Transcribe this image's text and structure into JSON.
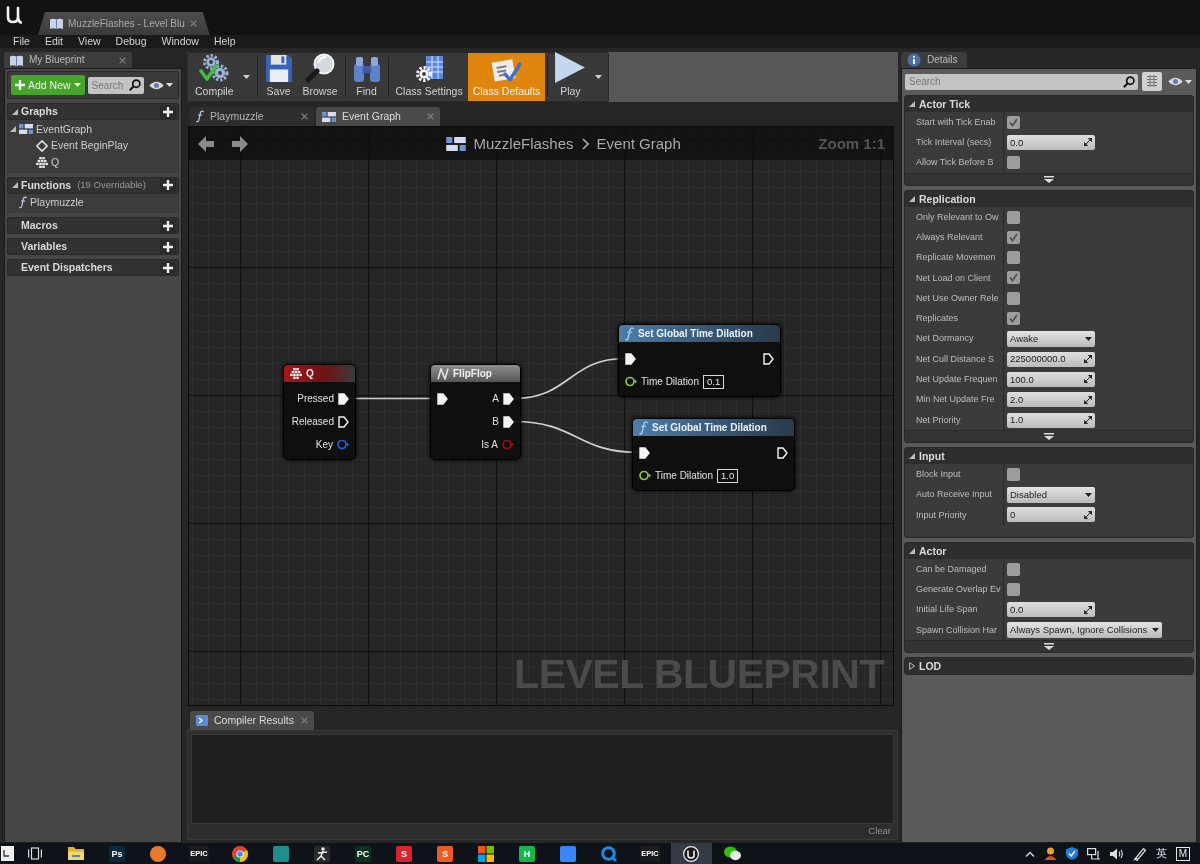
{
  "window": {
    "tab_title": "MuzzleFlashes - Level Blu"
  },
  "menu": [
    "File",
    "Edit",
    "View",
    "Debug",
    "Window",
    "Help"
  ],
  "my_blueprint": {
    "tab": "My Blueprint",
    "add_button": "Add New",
    "search": {
      "placeholder": "Search"
    },
    "sections": [
      {
        "title": "Graphs",
        "expanded": true,
        "items": [
          {
            "label": "EventGraph",
            "kind": "graph",
            "expanded": true,
            "children": [
              {
                "label": "Event BeginPlay",
                "kind": "event"
              },
              {
                "label": "Q",
                "kind": "input-key"
              }
            ]
          }
        ]
      },
      {
        "title": "Functions",
        "count": "(19 Overridable)",
        "expanded": true,
        "items": [
          {
            "label": "Playmuzzle",
            "kind": "function"
          }
        ]
      },
      {
        "title": "Macros"
      },
      {
        "title": "Variables"
      },
      {
        "title": "Event Dispatchers"
      }
    ]
  },
  "toolbar": [
    {
      "label": "Compile",
      "kind": "compile",
      "selected": false,
      "dropdown": true,
      "separator_before": false
    },
    {
      "label": "Save",
      "kind": "save",
      "selected": false,
      "dropdown": false,
      "separator_before": true
    },
    {
      "label": "Browse",
      "kind": "browse",
      "selected": false,
      "dropdown": false,
      "separator_before": false
    },
    {
      "label": "Find",
      "kind": "find",
      "selected": false,
      "dropdown": false,
      "separator_before": true
    },
    {
      "label": "Class Settings",
      "kind": "class-settings",
      "selected": false,
      "dropdown": false,
      "separator_before": true
    },
    {
      "label": "Class Defaults",
      "kind": "class-defaults",
      "selected": true,
      "dropdown": false,
      "separator_before": false
    },
    {
      "label": "Play",
      "kind": "play",
      "selected": false,
      "dropdown": true,
      "separator_before": true
    }
  ],
  "graph_tabs": [
    {
      "label": "Playmuzzle",
      "kind": "function",
      "selected": false
    },
    {
      "label": "Event Graph",
      "kind": "graph",
      "selected": true
    }
  ],
  "graph": {
    "breadcrumb": [
      "MuzzleFlashes",
      "Event Graph"
    ],
    "zoom": "Zoom 1:1",
    "label": "LEVEL BLUEPRINT",
    "nodes": [
      {
        "title": "Q",
        "kind": "event",
        "outputs": [
          {
            "label": "Pressed",
            "kind": "exec",
            "connected": true
          },
          {
            "label": "Released",
            "kind": "exec",
            "connected": false
          },
          {
            "label": "Key",
            "kind": "data",
            "color": "#1f63d6",
            "connected": false
          }
        ]
      },
      {
        "title": "FlipFlop",
        "kind": "macro",
        "inputs": [
          {
            "kind": "exec",
            "connected": true
          }
        ],
        "outputs": [
          {
            "label": "A",
            "kind": "exec",
            "connected": true
          },
          {
            "label": "B",
            "kind": "exec",
            "connected": true
          },
          {
            "label": "Is A",
            "kind": "data",
            "color": "#a00d0d",
            "connected": false
          }
        ]
      },
      {
        "title": "Set Global Time Dilation",
        "kind": "function",
        "inputs": [
          {
            "kind": "exec",
            "connected": true
          },
          {
            "label": "Time Dilation",
            "kind": "data",
            "color": "#8cc63f",
            "connected": false,
            "value": "0.1"
          }
        ],
        "outputs": [
          {
            "kind": "exec",
            "connected": false
          }
        ]
      },
      {
        "title": "Set Global Time Dilation",
        "kind": "function",
        "inputs": [
          {
            "kind": "exec",
            "connected": true
          },
          {
            "label": "Time Dilation",
            "kind": "data",
            "color": "#8cc63f",
            "connected": false,
            "value": "1.0"
          }
        ],
        "outputs": [
          {
            "kind": "exec",
            "connected": false
          }
        ]
      }
    ]
  },
  "compiler": {
    "tab": "Compiler Results",
    "clear_button": "Clear"
  },
  "details": {
    "tab": "Details",
    "search": {
      "placeholder": "Search"
    },
    "sections": [
      {
        "title": "Actor Tick",
        "expanded": true,
        "advanced_toggle": true,
        "rows": [
          {
            "label": "Start with Tick Enab",
            "kind": "checkbox",
            "checked": true
          },
          {
            "label": "Tick Interval (secs)",
            "kind": "number",
            "value": "0.0"
          },
          {
            "label": "Allow Tick Before B",
            "kind": "checkbox",
            "checked": false
          }
        ]
      },
      {
        "title": "Replication",
        "expanded": true,
        "advanced_toggle": true,
        "rows": [
          {
            "label": "Only Relevant to Ow",
            "kind": "checkbox",
            "checked": false
          },
          {
            "label": "Always Relevant",
            "kind": "checkbox",
            "checked": true
          },
          {
            "label": "Replicate Movemen",
            "kind": "checkbox",
            "checked": false
          },
          {
            "label": "Net Load on Client",
            "kind": "checkbox",
            "checked": true
          },
          {
            "label": "Net Use Owner Rele",
            "kind": "checkbox",
            "checked": false
          },
          {
            "label": "Replicates",
            "kind": "checkbox",
            "checked": true
          },
          {
            "label": "Net Dormancy",
            "kind": "dropdown",
            "value": "Awake"
          },
          {
            "label": "Net Cull Distance S",
            "kind": "number",
            "value": "225000000.0"
          },
          {
            "label": "Net Update Frequen",
            "kind": "number",
            "value": "100.0"
          },
          {
            "label": "Min Net Update Fre",
            "kind": "number",
            "value": "2.0"
          },
          {
            "label": "Net Priority",
            "kind": "number",
            "value": "1.0"
          }
        ]
      },
      {
        "title": "Input",
        "expanded": true,
        "advanced_toggle": false,
        "rows": [
          {
            "label": "Block Input",
            "kind": "checkbox",
            "checked": false
          },
          {
            "label": "Auto Receive Input",
            "kind": "dropdown",
            "value": "Disabled"
          },
          {
            "label": "Input Priority",
            "kind": "number",
            "value": "0"
          }
        ]
      },
      {
        "title": "Actor",
        "expanded": true,
        "advanced_toggle": true,
        "rows": [
          {
            "label": "Can be Damaged",
            "kind": "checkbox",
            "checked": false
          },
          {
            "label": "Generate Overlap Ev",
            "kind": "checkbox",
            "checked": false
          },
          {
            "label": "Initial Life Span",
            "kind": "number",
            "value": "0.0"
          },
          {
            "label": "Spawn Collision Har",
            "kind": "dropdown",
            "value": "Always Spawn, Ignore Collisions"
          }
        ]
      },
      {
        "title": "LOD",
        "expanded": false
      }
    ]
  },
  "taskbar": {
    "apps": [
      {
        "kind": "start",
        "selected": false
      },
      {
        "kind": "task-view",
        "selected": false
      },
      {
        "kind": "folder",
        "selected": false
      },
      {
        "kind": "tile",
        "color": "#0b2744",
        "glyph": "Ps",
        "selected": false
      },
      {
        "kind": "circle",
        "color": "#e8792c",
        "selected": false
      },
      {
        "kind": "tile",
        "color": "#1c1c1c",
        "glyph": "EPIC",
        "selected": false
      },
      {
        "kind": "chrome",
        "selected": false
      },
      {
        "kind": "tile",
        "color": "#1f8f8a",
        "selected": false
      },
      {
        "kind": "figure",
        "selected": false
      },
      {
        "kind": "tile",
        "color": "#10301f",
        "glyph": "PC",
        "selected": false
      },
      {
        "kind": "tile",
        "color": "#d9252a",
        "glyph": "S",
        "selected": false
      },
      {
        "kind": "tile",
        "color": "#ef5a24",
        "glyph": "S",
        "selected": false
      },
      {
        "kind": "grid",
        "selected": false
      },
      {
        "kind": "tile",
        "color": "#19b24b",
        "glyph": "H",
        "selected": false
      },
      {
        "kind": "tile",
        "color": "#3a86f5",
        "selected": false
      },
      {
        "kind": "ring",
        "color": "#1e88e5",
        "selected": false
      },
      {
        "kind": "tile",
        "color": "#1c1c1c",
        "glyph": "EPIC",
        "selected": false
      },
      {
        "kind": "ue",
        "selected": true
      },
      {
        "kind": "wechat",
        "selected": false
      }
    ],
    "tray": [
      {
        "kind": "chevron"
      },
      {
        "kind": "person"
      },
      {
        "kind": "shield"
      },
      {
        "kind": "network"
      },
      {
        "kind": "volume"
      },
      {
        "kind": "pen"
      },
      {
        "kind": "text",
        "text": "英"
      },
      {
        "kind": "boxed",
        "text": "M"
      }
    ]
  }
}
